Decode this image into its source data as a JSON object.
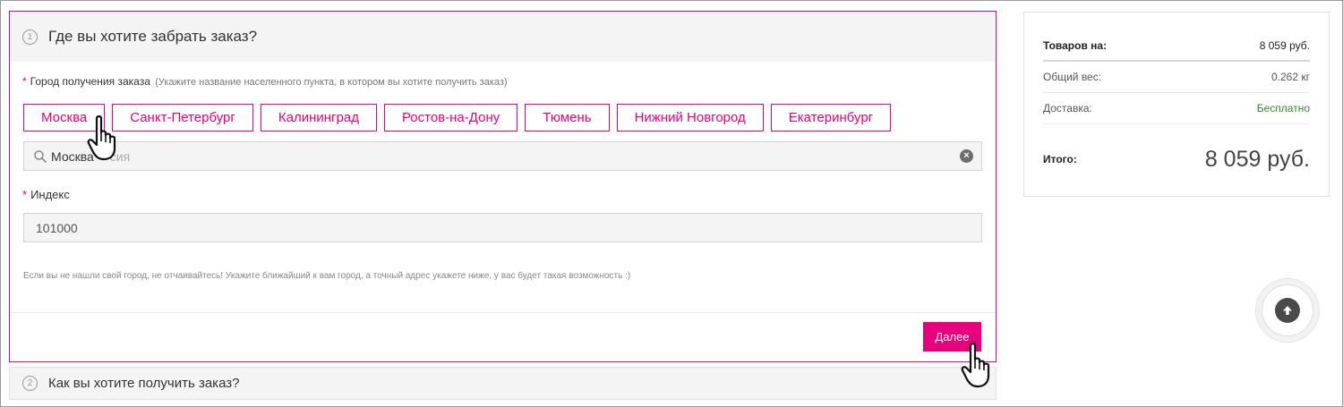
{
  "step1": {
    "number": "1",
    "title": "Где вы хотите забрать заказ?",
    "city_label": "Город получения заказа",
    "city_hint": "(Укажите название населенного пункта, в котором вы хотите получить заказ)",
    "required_mark": "*",
    "cities": [
      "Москва",
      "Санкт-Петербург",
      "Калининград",
      "Ростов-на-Дону",
      "Тюмень",
      "Нижний Новгород",
      "Екатеринбург"
    ],
    "search_value": "Москва",
    "search_ghost": "сия",
    "clear_symbol": "×",
    "index_label": "Индекс",
    "index_value": "101000",
    "note": "Если вы не нашли свой город, не отчаивайтесь! Укажите ближайший к вам город, а точный адрес укажете ниже, у вас будет такая возможность :)",
    "next_label": "Далее"
  },
  "step2": {
    "number": "2",
    "title": "Как вы хотите получить заказ?"
  },
  "summary": {
    "goods_label": "Товаров на:",
    "goods_value": "8 059 руб.",
    "weight_label": "Общий вес:",
    "weight_value": "0.262 кг",
    "delivery_label": "Доставка:",
    "delivery_value": "Бесплатно",
    "total_label": "Итого:",
    "total_value": "8 059 руб."
  },
  "colors": {
    "accent": "#e6007e",
    "free_delivery": "#2e8b2e"
  },
  "icons": {
    "search": "search-icon",
    "clear": "clear-icon",
    "scroll_top": "arrow-up-icon",
    "cursor": "hand-pointer-icon"
  }
}
